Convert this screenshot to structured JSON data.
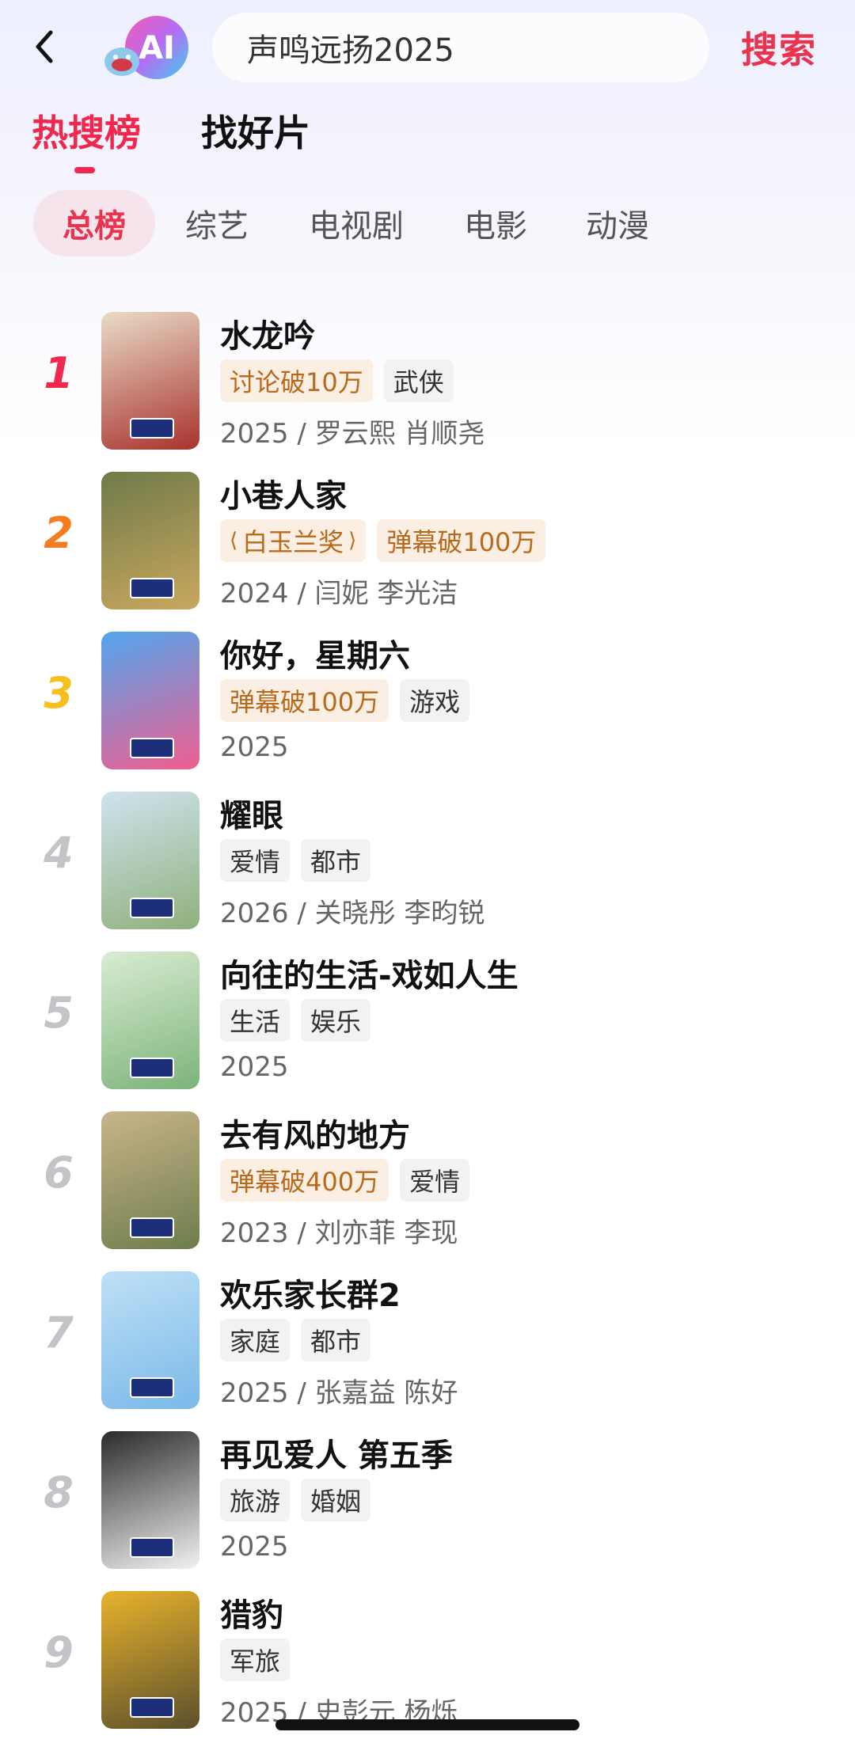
{
  "header": {
    "back_icon": "chevron-left-icon",
    "logo_text": "AI",
    "search_value": "声鸣远扬2025",
    "search_label": "搜索"
  },
  "main_tabs": [
    {
      "label": "热搜榜",
      "active": true
    },
    {
      "label": "找好片",
      "active": false
    }
  ],
  "sub_tabs": [
    {
      "label": "总榜",
      "active": true
    },
    {
      "label": "综艺",
      "active": false
    },
    {
      "label": "电视剧",
      "active": false
    },
    {
      "label": "电影",
      "active": false
    },
    {
      "label": "动漫",
      "active": false
    }
  ],
  "colors": {
    "accent": "#f0284d",
    "rank1": "#f0284d",
    "rank2": "#f57c1f",
    "rank3": "#f6bf1d",
    "rank_other": "#c4c4c8"
  },
  "items": [
    {
      "rank": "1",
      "title": "水龙吟",
      "tags": [
        {
          "text": "讨论破10万",
          "hot": true
        },
        {
          "text": "武侠",
          "hot": false
        }
      ],
      "meta": "2025 / 罗云熙 肖顺尧",
      "poster_colors": [
        "#e9dcc8",
        "#a8322e"
      ]
    },
    {
      "rank": "2",
      "title": "小巷人家",
      "tags": [
        {
          "text": "白玉兰奖",
          "hot": true,
          "laurel": true
        },
        {
          "text": "弹幕破100万",
          "hot": true
        }
      ],
      "meta": "2024 / 闫妮 李光洁",
      "poster_colors": [
        "#6f7a4a",
        "#c9a85e"
      ]
    },
    {
      "rank": "3",
      "title": "你好，星期六",
      "tags": [
        {
          "text": "弹幕破100万",
          "hot": true
        },
        {
          "text": "游戏",
          "hot": false
        }
      ],
      "meta": "2025",
      "poster_colors": [
        "#52a6ef",
        "#f05e8e"
      ]
    },
    {
      "rank": "4",
      "title": "耀眼",
      "tags": [
        {
          "text": "爱情",
          "hot": false
        },
        {
          "text": "都市",
          "hot": false
        }
      ],
      "meta": "2026 / 关晓彤 李昀锐",
      "poster_colors": [
        "#cfe3ef",
        "#8fb07c"
      ]
    },
    {
      "rank": "5",
      "title": "向往的生活-戏如人生",
      "tags": [
        {
          "text": "生活",
          "hot": false
        },
        {
          "text": "娱乐",
          "hot": false
        }
      ],
      "meta": "2025",
      "poster_colors": [
        "#d9ecd2",
        "#7cb37a"
      ]
    },
    {
      "rank": "6",
      "title": "去有风的地方",
      "tags": [
        {
          "text": "弹幕破400万",
          "hot": true
        },
        {
          "text": "爱情",
          "hot": false
        }
      ],
      "meta": "2023 / 刘亦菲 李现",
      "poster_colors": [
        "#c9b48a",
        "#6d7d4c"
      ]
    },
    {
      "rank": "7",
      "title": "欢乐家长群2",
      "tags": [
        {
          "text": "家庭",
          "hot": false
        },
        {
          "text": "都市",
          "hot": false
        }
      ],
      "meta": "2025 / 张嘉益 陈好",
      "poster_colors": [
        "#bfe0f6",
        "#7ab9e8"
      ]
    },
    {
      "rank": "8",
      "title": "再见爱人 第五季",
      "tags": [
        {
          "text": "旅游",
          "hot": false
        },
        {
          "text": "婚姻",
          "hot": false
        }
      ],
      "meta": "2025",
      "poster_colors": [
        "#2b2b2b",
        "#f2f2f2"
      ]
    },
    {
      "rank": "9",
      "title": "猎豹",
      "tags": [
        {
          "text": "军旅",
          "hot": false
        }
      ],
      "meta": "2025 / 史彭元 杨烁",
      "poster_colors": [
        "#e8b32c",
        "#5b4f2c"
      ]
    }
  ]
}
